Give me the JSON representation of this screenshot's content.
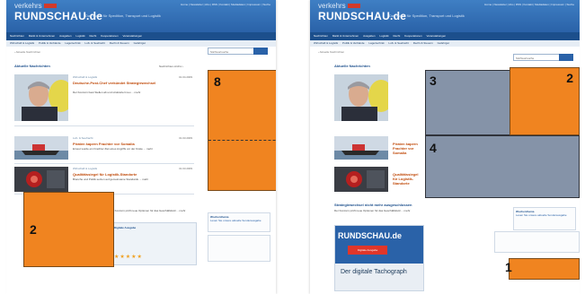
{
  "site": {
    "brand_small": "verkehrs",
    "brand_big": "RUNDSCHAU.de",
    "brand_tagline": "Das Portal für Spedition, Transport und Logistik",
    "top_links": "Home | Newsletter | Abo | RSS | Kontakt | Mediadaten | Impressum | Suche",
    "nav_primary": [
      "Nachrichten",
      "Markt & Unternehmen",
      "Ausgaben",
      "Logistik",
      "Recht",
      "Kooperationen",
      "Veranstaltungen",
      "Termine"
    ],
    "nav_secondary": [
      "Wirtschaft & Logistik",
      "Politik & Verbände",
      "Lagertechnik",
      "Luft- & Seefracht",
      "Recht & Steuern",
      "Gefahrgut"
    ],
    "search_placeholder": "Stichwortsuche",
    "breadcrumb": "› Aktuelle Nachrichten"
  },
  "content": {
    "section_title": "Aktuelle Nachrichten",
    "more_link": "Nachrichten-Archiv ›",
    "news": [
      {
        "category": "Wirtschaft & Logistik",
        "date": "01.04.2009",
        "headline": "Deutsche-Post-Chef verkündet Strategiewechsel",
        "teaser": "Der Konzern baut Stellen ab und strukturiert neu ... mehr"
      },
      {
        "category": "Luft- & Seefracht",
        "date": "31.03.2009",
        "headline": "Piraten kapern Frachter vor Somalia",
        "teaser": "Erneut wurde ein Frachter Ziel eines Angriffs vor der Küste ... mehr"
      },
      {
        "category": "Wirtschaft & Logistik",
        "date": "31.03.2009",
        "headline": "Qualitätssiegel für Logistik-Standorte",
        "teaser": "Branche und Politik setzen auf gemeinsame Standards ... mehr"
      }
    ],
    "lower_title": "Strategiewechsel nicht mehr ausgeschlossen",
    "lower_teaser": "Der Konzern prüft neue Optionen für das Geschäftsfeld ... mehr"
  },
  "sidebar": {
    "infobox_title": "Wochenthema",
    "infobox_text": "Lesen Sie unsere aktuelle Sonderausgabe",
    "ad_badge": "Digitale Ausgabe",
    "ad_title": "Der digitale Tachograph",
    "rating_stars": "★★★★★"
  },
  "overlays": {
    "left_page": [
      {
        "label": "8",
        "kind": "orange",
        "has_dashed_split": true
      },
      {
        "label": "2",
        "kind": "orange",
        "has_dashed_split": false
      }
    ],
    "right_page": [
      {
        "label": "3",
        "kind": "gray",
        "has_dashed_split": false
      },
      {
        "label": "2",
        "kind": "orange",
        "has_dashed_split": false
      },
      {
        "label": "4",
        "kind": "gray",
        "has_dashed_split": false
      },
      {
        "label": "1",
        "kind": "orange",
        "has_dashed_split": false
      }
    ],
    "colors": {
      "orange": "#f08420",
      "gray": "#78879e",
      "header_blue": "#2a62a8",
      "headline_orange": "#c04a0a"
    }
  }
}
